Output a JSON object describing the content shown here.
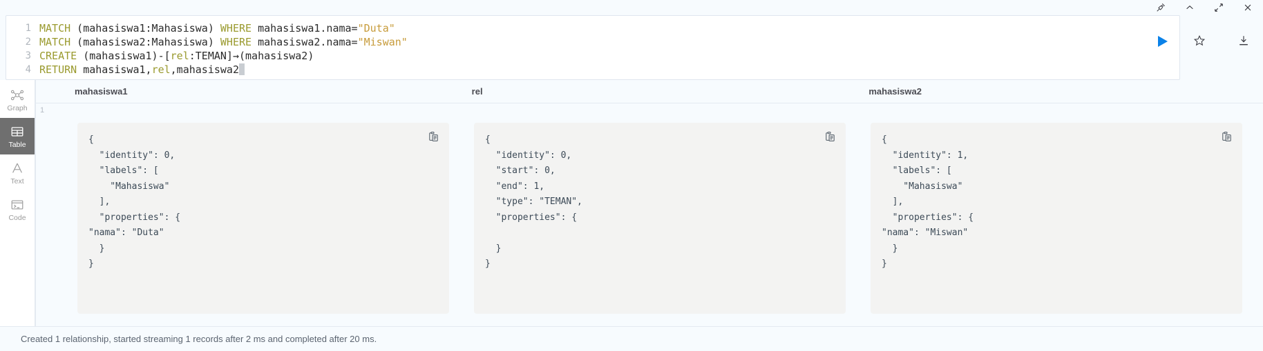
{
  "frame": {
    "icons": [
      {
        "name": "pin-icon",
        "label": "Pin"
      },
      {
        "name": "chevron-up-icon",
        "label": "Collapse"
      },
      {
        "name": "expand-icon",
        "label": "Expand"
      },
      {
        "name": "close-icon",
        "label": "Close"
      }
    ]
  },
  "editor": {
    "lines": [
      {
        "number": "1",
        "tokens": [
          {
            "text": "MATCH",
            "cls": "t-kw"
          },
          {
            "text": " (mahasiswa1:Mahasiswa) ",
            "cls": "t-plain"
          },
          {
            "text": "WHERE",
            "cls": "t-kw"
          },
          {
            "text": " mahasiswa1.nama=",
            "cls": "t-plain"
          },
          {
            "text": "\"Duta\"",
            "cls": "t-str"
          }
        ]
      },
      {
        "number": "2",
        "tokens": [
          {
            "text": "MATCH",
            "cls": "t-kw"
          },
          {
            "text": " (mahasiswa2:Mahasiswa) ",
            "cls": "t-plain"
          },
          {
            "text": "WHERE",
            "cls": "t-kw"
          },
          {
            "text": " mahasiswa2.nama=",
            "cls": "t-plain"
          },
          {
            "text": "\"Miswan\"",
            "cls": "t-str"
          }
        ]
      },
      {
        "number": "3",
        "tokens": [
          {
            "text": "CREATE",
            "cls": "t-kw"
          },
          {
            "text": " (mahasiswa1)-[",
            "cls": "t-plain"
          },
          {
            "text": "rel",
            "cls": "t-rel"
          },
          {
            "text": ":TEMAN]→(mahasiswa2)",
            "cls": "t-plain"
          }
        ]
      },
      {
        "number": "4",
        "tokens": [
          {
            "text": "RETURN",
            "cls": "t-kw"
          },
          {
            "text": " mahasiswa1,",
            "cls": "t-plain"
          },
          {
            "text": "rel",
            "cls": "t-rel"
          },
          {
            "text": ",mahasiswa2",
            "cls": "t-plain"
          }
        ]
      }
    ],
    "run_button_label": "Run query",
    "run_button_color": "#0b82e8",
    "actions": [
      {
        "name": "favorite-star-icon",
        "label": "Save as favorite"
      },
      {
        "name": "download-icon",
        "label": "Download"
      }
    ]
  },
  "sidebar": {
    "items": [
      {
        "label": "Graph",
        "icon": "graph-icon",
        "active": false
      },
      {
        "label": "Table",
        "icon": "table-icon",
        "active": true
      },
      {
        "label": "Text",
        "icon": "text-icon",
        "active": false
      },
      {
        "label": "Code",
        "icon": "code-icon",
        "active": false
      }
    ]
  },
  "results": {
    "columns": [
      "mahasiswa1",
      "rel",
      "mahasiswa2"
    ],
    "row_number": "1",
    "copy_label": "Copy to clipboard",
    "cells": [
      "{\n  \"identity\": 0,\n  \"labels\": [\n    \"Mahasiswa\"\n  ],\n  \"properties\": {\n\"nama\": \"Duta\"\n  }\n}",
      "{\n  \"identity\": 0,\n  \"start\": 0,\n  \"end\": 1,\n  \"type\": \"TEMAN\",\n  \"properties\": {\n\n  }\n}",
      "{\n  \"identity\": 1,\n  \"labels\": [\n    \"Mahasiswa\"\n  ],\n  \"properties\": {\n\"nama\": \"Miswan\"\n  }\n}"
    ]
  },
  "status": {
    "message": "Created 1 relationship, started streaming 1 records after 2 ms and completed after 20 ms."
  }
}
